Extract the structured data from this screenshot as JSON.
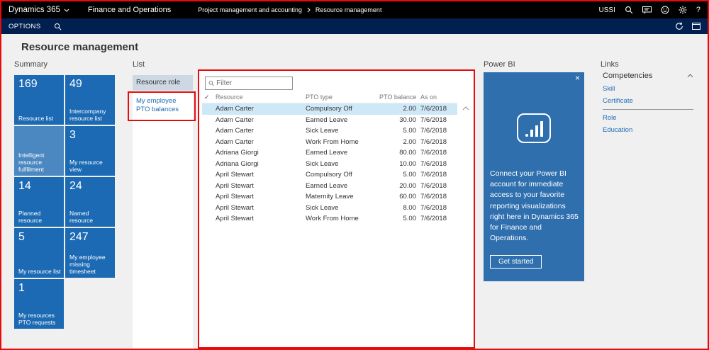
{
  "topbar": {
    "brand": "Dynamics 365",
    "app": "Finance and Operations",
    "breadcrumb_1": "Project management and accounting",
    "breadcrumb_2": "Resource management",
    "company": "USSI",
    "help": "?"
  },
  "actionbar": {
    "options": "OPTIONS"
  },
  "page": {
    "title": "Resource management"
  },
  "summary": {
    "label": "Summary",
    "tiles": [
      {
        "count": "169",
        "label": "Resource list",
        "variant": "normal"
      },
      {
        "count": "49",
        "label": "Intercompany resource list",
        "variant": "normal"
      },
      {
        "count": "",
        "label": "Intelligent resource fulfillment",
        "variant": "light"
      },
      {
        "count": "3",
        "label": "My resource view",
        "variant": "normal"
      },
      {
        "count": "14",
        "label": "Planned resource",
        "variant": "normal"
      },
      {
        "count": "24",
        "label": "Named resource",
        "variant": "normal"
      },
      {
        "count": "5",
        "label": "My resource list",
        "variant": "normal"
      },
      {
        "count": "247",
        "label": "My employee missing timesheet",
        "variant": "normal"
      },
      {
        "count": "1",
        "label": "My resources PTO requests",
        "variant": "normal"
      }
    ]
  },
  "list_panel": {
    "label": "List",
    "header": "Resource role",
    "item": "My employee PTO balances"
  },
  "grid": {
    "filter_placeholder": "Filter",
    "columns": {
      "check": "✓",
      "resource": "Resource",
      "pto_type": "PTO type",
      "balances": "PTO balances",
      "as_on": "As on"
    },
    "rows": [
      {
        "resource": "Adam Carter",
        "pto_type": "Compulsory Off",
        "balance": "2.00",
        "as_on": "7/6/2018",
        "state": "selected"
      },
      {
        "resource": "Adam Carter",
        "pto_type": "Earned Leave",
        "balance": "30.00",
        "as_on": "7/6/2018",
        "state": ""
      },
      {
        "resource": "Adam Carter",
        "pto_type": "Sick Leave",
        "balance": "5.00",
        "as_on": "7/6/2018",
        "state": ""
      },
      {
        "resource": "Adam Carter",
        "pto_type": "Work From Home",
        "balance": "2.00",
        "as_on": "7/6/2018",
        "state": ""
      },
      {
        "resource": "Adriana Giorgi",
        "pto_type": "Earned Leave",
        "balance": "80.00",
        "as_on": "7/6/2018",
        "state": ""
      },
      {
        "resource": "Adriana Giorgi",
        "pto_type": "Sick Leave",
        "balance": "10.00",
        "as_on": "7/6/2018",
        "state": ""
      },
      {
        "resource": "April Stewart",
        "pto_type": "Compulsory Off",
        "balance": "5.00",
        "as_on": "7/6/2018",
        "state": ""
      },
      {
        "resource": "April Stewart",
        "pto_type": "Earned Leave",
        "balance": "20.00",
        "as_on": "7/6/2018",
        "state": ""
      },
      {
        "resource": "April Stewart",
        "pto_type": "Maternity Leave",
        "balance": "60.00",
        "as_on": "7/6/2018",
        "state": ""
      },
      {
        "resource": "April Stewart",
        "pto_type": "Sick Leave",
        "balance": "8.00",
        "as_on": "7/6/2018",
        "state": ""
      },
      {
        "resource": "April Stewart",
        "pto_type": "Work From Home",
        "balance": "5.00",
        "as_on": "7/6/2018",
        "state": ""
      }
    ]
  },
  "powerbi": {
    "label": "Power BI",
    "close": "×",
    "message": "Connect your Power BI account for immediate access to your favorite reporting visualizations right here in Dynamics 365 for Finance and Operations.",
    "button": "Get started"
  },
  "links": {
    "label": "Links",
    "group": "Competencies",
    "items_top": [
      "Skill",
      "Certificate"
    ],
    "items_bottom": [
      "Role",
      "Education"
    ]
  },
  "colors": {
    "tile_blue": "#1b6ab3",
    "tile_light_blue": "#4b87c0",
    "powerbi_blue": "#2f6fae",
    "link_blue": "#1f6cb5",
    "selected_row": "#cfe8f8",
    "annotation_red": "#e60c0c"
  }
}
